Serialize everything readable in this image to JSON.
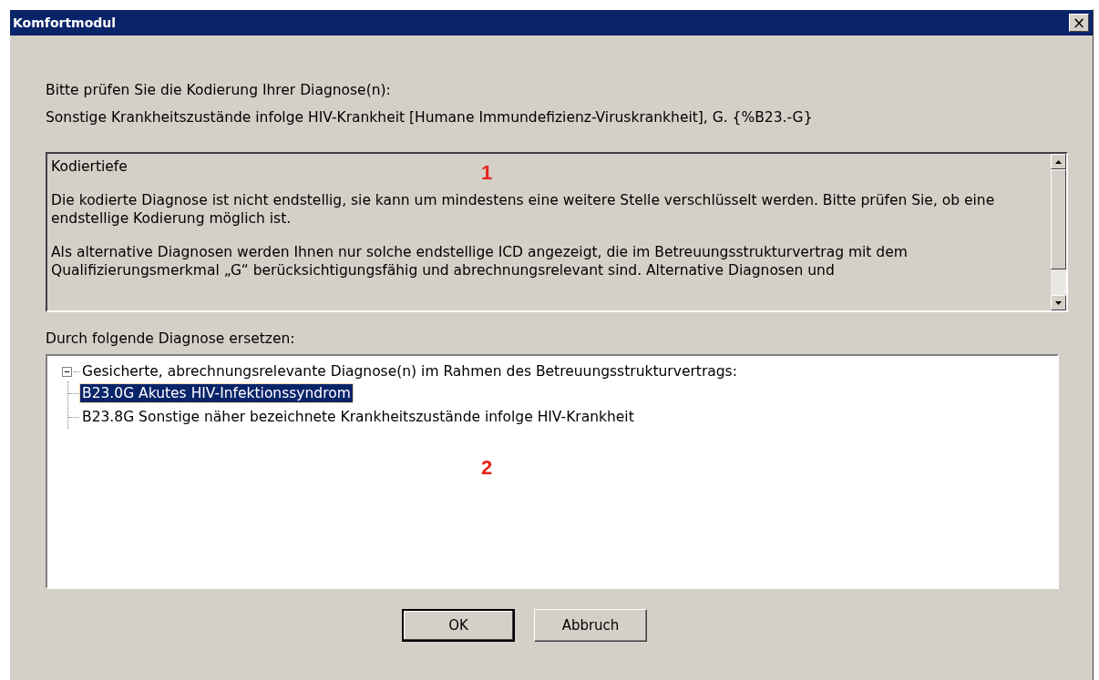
{
  "window": {
    "title": "Komfortmodul",
    "close": "×"
  },
  "prompt": "Bitte prüfen Sie die Kodierung Ihrer Diagnose(n):",
  "diagnosis": "Sonstige Krankheitszustände infolge HIV-Krankheit [Humane Immundefizienz-Viruskrankheit], G. {%B23.-G}",
  "info_panel": {
    "marker": "1",
    "paragraphs": [
      "Kodiertiefe",
      "Die kodierte Diagnose ist nicht endstellig, sie kann um mindestens eine weitere Stelle verschlüsselt werden. Bitte prüfen Sie, ob eine endstellige Kodierung möglich ist.",
      "Als alternative Diagnosen werden Ihnen nur solche endstellige ICD angezeigt, die im Betreuungsstrukturvertrag mit dem Qualifizierungsmerkmal „G“ berücksichtigungsfähig und abrechnungsrelevant sind. Alternative Diagnosen und"
    ]
  },
  "replace_label": "Durch folgende Diagnose ersetzen:",
  "tree": {
    "marker": "2",
    "items": [
      {
        "label": "Gesicherte, abrechnungsrelevante Diagnose(n) im Rahmen des Betreuungsstrukturvertrags:",
        "expanded": true,
        "selected": false,
        "children": [
          {
            "label": "B23.0G Akutes HIV-Infektionssyndrom",
            "selected": true
          },
          {
            "label": "B23.8G Sonstige näher bezeichnete Krankheitszustände infolge HIV-Krankheit",
            "selected": false
          }
        ]
      }
    ]
  },
  "buttons": [
    {
      "label": "OK",
      "default": true
    },
    {
      "label": "Abbruch",
      "default": false
    }
  ]
}
